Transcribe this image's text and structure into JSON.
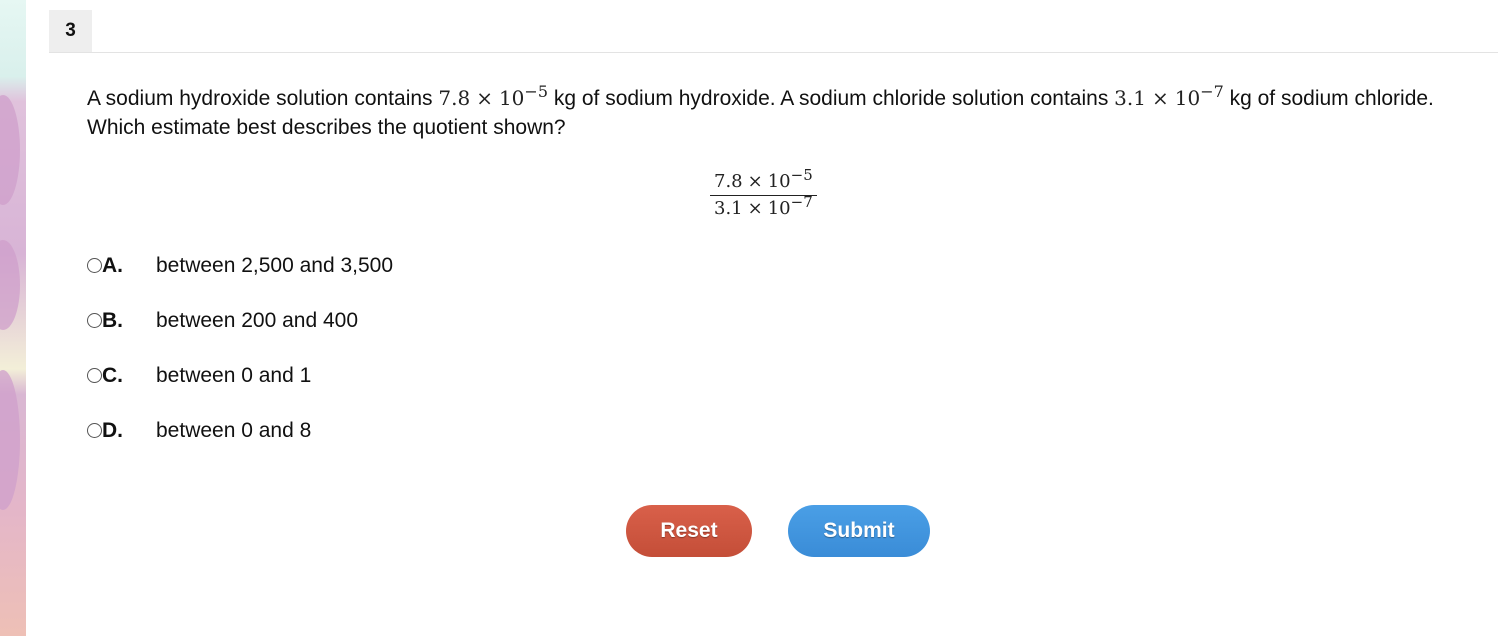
{
  "question": {
    "number": "3",
    "text_part1": "A sodium hydroxide solution contains ",
    "mass1": {
      "coefficient": "7.8",
      "operator": "×",
      "base": "10",
      "exponent": "−5"
    },
    "text_part2": " kg of sodium hydroxide. A sodium chloride solution contains ",
    "mass2": {
      "coefficient": "3.1",
      "operator": "×",
      "base": "10",
      "exponent": "−7"
    },
    "text_part3": " kg of sodium chloride. Which estimate best describes the quotient shown?",
    "fraction": {
      "numerator": {
        "coefficient": "7.8",
        "operator": "×",
        "base": "10",
        "exponent": "−5"
      },
      "denominator": {
        "coefficient": "3.1",
        "operator": "×",
        "base": "10",
        "exponent": "−7"
      }
    }
  },
  "choices": [
    {
      "letter": "A.",
      "text": "between 2,500 and 3,500",
      "selected": false
    },
    {
      "letter": "B.",
      "text": "between 200 and 400",
      "selected": false
    },
    {
      "letter": "C.",
      "text": "between 0 and 1",
      "selected": false
    },
    {
      "letter": "D.",
      "text": "between 0 and 8",
      "selected": false
    }
  ],
  "buttons": {
    "reset_label": "Reset",
    "submit_label": "Submit"
  },
  "colors": {
    "reset": "#c9533d",
    "submit": "#3d91db",
    "header_bg": "#eeeeee"
  }
}
